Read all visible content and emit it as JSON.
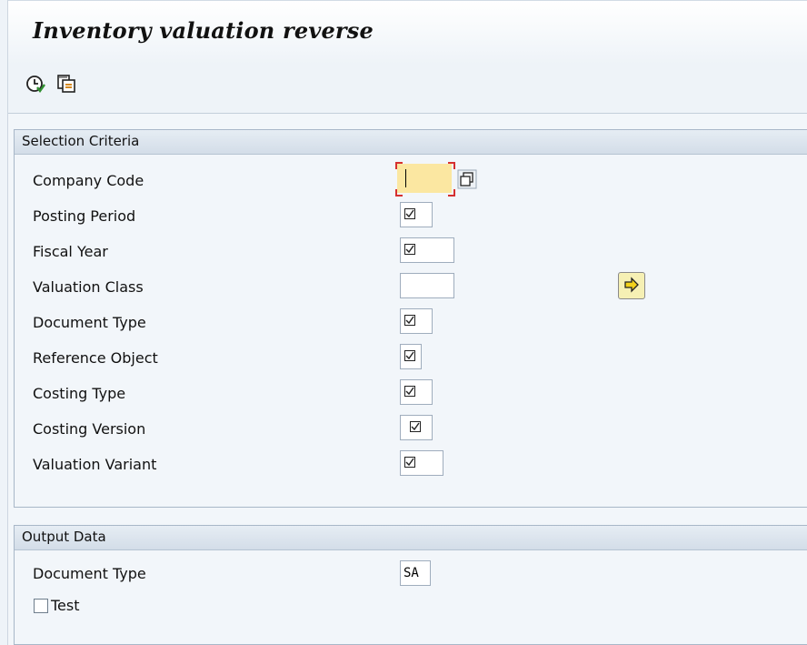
{
  "window": {
    "title": "Inventory valuation reverse"
  },
  "toolbar": {
    "execute_icon": "clock-execute-icon",
    "variant_icon": "copy-variant-icon"
  },
  "selection": {
    "header": "Selection Criteria",
    "rows": [
      {
        "label": "Company Code",
        "value": ""
      },
      {
        "label": "Posting Period",
        "value": ""
      },
      {
        "label": "Fiscal Year",
        "value": ""
      },
      {
        "label": "Valuation Class",
        "value": ""
      },
      {
        "label": "Document Type",
        "value": ""
      },
      {
        "label": "Reference Object",
        "value": ""
      },
      {
        "label": "Costing Type",
        "value": ""
      },
      {
        "label": "Costing Version",
        "value": ""
      },
      {
        "label": "Valuation Variant",
        "value": ""
      }
    ]
  },
  "output": {
    "header": "Output Data",
    "doc_type_label": "Document Type",
    "doc_type_value": "SA",
    "test_label": "Test"
  },
  "colors": {
    "focus_field": "#fbe7a1",
    "multi_select_button": "#f6f0b4",
    "panel": "#f2f6fa"
  }
}
